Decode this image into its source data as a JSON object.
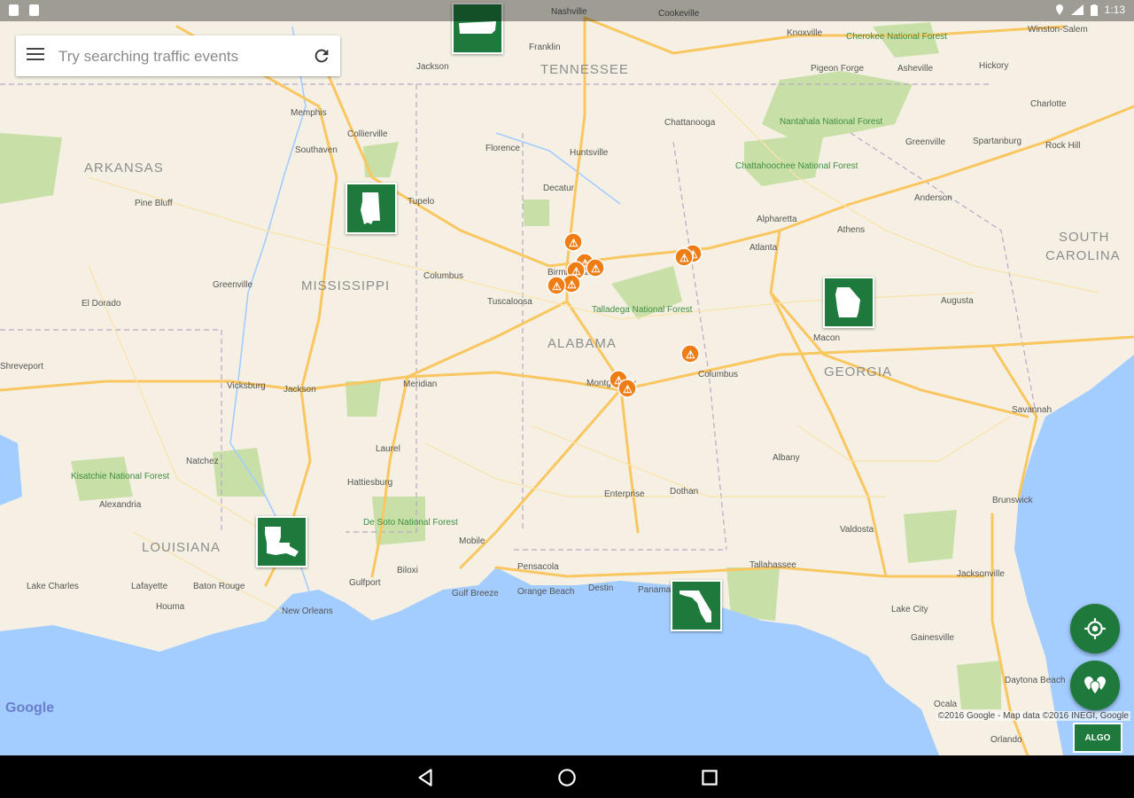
{
  "status_bar": {
    "time": "1:13"
  },
  "search": {
    "placeholder": "Try searching traffic events"
  },
  "map": {
    "states": [
      "ARKANSAS",
      "TENNESSEE",
      "MISSISSIPPI",
      "ALABAMA",
      "GEORGIA",
      "SOUTH",
      "CAROLINA",
      "LOUISIANA"
    ],
    "cities": [
      "Nashville",
      "Knoxville",
      "Winston-Salem",
      "Jackson",
      "Franklin",
      "Cookeville",
      "Asheville",
      "Hickory",
      "Pigeon Forge",
      "Memphis",
      "Collierville",
      "Chattanooga",
      "Charlotte",
      "Southaven",
      "Florence",
      "Huntsville",
      "Greenville",
      "Spartanburg",
      "Rock Hill",
      "Decatur",
      "Pine Bluff",
      "Tupelo",
      "Anderson",
      "Alpharetta",
      "Athens",
      "Atlanta",
      "Columbus",
      "Greenville",
      "Birmingham",
      "Tuscaloosa",
      "Augusta",
      "El Dorado",
      "Macon",
      "Montgomery",
      "Columbus",
      "Shreveport",
      "Vicksburg",
      "Jackson",
      "Meridian",
      "Savannah",
      "Laurel",
      "Natchez",
      "Albany",
      "Hattiesburg",
      "Enterprise",
      "Dothan",
      "Brunswick",
      "Alexandria",
      "Valdosta",
      "Mobile",
      "Pensacola",
      "Tallahassee",
      "Lake Charles",
      "Lafayette",
      "Baton Rouge",
      "Gulfport",
      "Biloxi",
      "Jacksonville",
      "New Orleans",
      "Houma",
      "Lake City",
      "Gainesville",
      "Ocala",
      "Daytona Beach",
      "Orlando",
      "Panama City",
      "Destin",
      "Gulf Breeze",
      "Orange Beach"
    ],
    "forests": [
      "Cherokee National Forest",
      "Nantahala National Forest",
      "Chattahoochee National Forest",
      "Talladega National Forest",
      "Kisatchie National Forest",
      "De Soto National Forest"
    ],
    "copyright": "©2016 Google - Map data ©2016 INEGI, Google",
    "google_logo": "Google"
  },
  "state_buttons": [
    "tennessee",
    "mississippi",
    "georgia",
    "louisiana",
    "florida"
  ],
  "fabs": {
    "locate_icon": "my-location-icon",
    "layers_icon": "map-pins-icon"
  },
  "app_logo": "ALGO",
  "colors": {
    "primary": "#1e7a3c",
    "event": "#ef7d16",
    "water": "#a3ccff",
    "land": "#f5f0e3",
    "park": "#c8e0a8",
    "road": "#f9c660"
  }
}
